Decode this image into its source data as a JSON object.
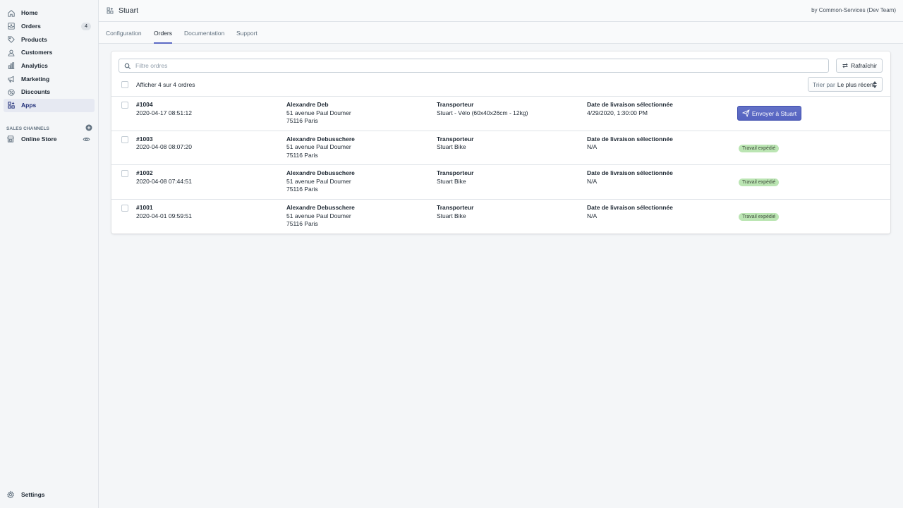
{
  "sidebar": {
    "items": [
      {
        "label": "Home",
        "icon": "home-icon"
      },
      {
        "label": "Orders",
        "icon": "orders-icon",
        "badge": "4"
      },
      {
        "label": "Products",
        "icon": "tag-icon"
      },
      {
        "label": "Customers",
        "icon": "person-icon"
      },
      {
        "label": "Analytics",
        "icon": "bar-chart-icon"
      },
      {
        "label": "Marketing",
        "icon": "megaphone-icon"
      },
      {
        "label": "Discounts",
        "icon": "discount-icon"
      },
      {
        "label": "Apps",
        "icon": "apps-icon",
        "active": true
      }
    ],
    "sales_channels_label": "SALES CHANNELS",
    "online_store_label": "Online Store",
    "settings_label": "Settings"
  },
  "header": {
    "app_title": "Stuart",
    "by_text": "by Common-Services (Dev Team)"
  },
  "tabs": [
    {
      "label": "Configuration"
    },
    {
      "label": "Orders",
      "active": true
    },
    {
      "label": "Documentation"
    },
    {
      "label": "Support"
    }
  ],
  "toolbar": {
    "search_placeholder": "Filtre ordres",
    "refresh_label": "Rafraîchir",
    "count_text": "Afficher 4 sur 4 ordres",
    "sort_prefix": "Trier par",
    "sort_value": "Le plus récent"
  },
  "orders": [
    {
      "id": "#1004",
      "date": "2020-04-17 08:51:12",
      "name": "Alexandre Deb",
      "address1": "51 avenue Paul Doumer",
      "address2": "75116 Paris",
      "carrier_label": "Transporteur",
      "carrier": "Stuart - Vélo (60x40x26cm - 12kg)",
      "delivery_label": "Date de livraison sélectionnée",
      "delivery": "4/29/2020, 1:30:00 PM",
      "action": "Envoyer à Stuart"
    },
    {
      "id": "#1003",
      "date": "2020-04-08 08:07:20",
      "name": "Alexandre Debusschere",
      "address1": "51 avenue Paul Doumer",
      "address2": "75116 Paris",
      "carrier_label": "Transporteur",
      "carrier": "Stuart Bike",
      "delivery_label": "Date de livraison sélectionnée",
      "delivery": "N/A",
      "status": "Travail expédié"
    },
    {
      "id": "#1002",
      "date": "2020-04-08 07:44:51",
      "name": "Alexandre Debusschere",
      "address1": "51 avenue Paul Doumer",
      "address2": "75116 Paris",
      "carrier_label": "Transporteur",
      "carrier": "Stuart Bike",
      "delivery_label": "Date de livraison sélectionnée",
      "delivery": "N/A",
      "status": "Travail expédié"
    },
    {
      "id": "#1001",
      "date": "2020-04-01 09:59:51",
      "name": "Alexandre Debusschere",
      "address1": "51 avenue Paul Doumer",
      "address2": "75116 Paris",
      "carrier_label": "Transporteur",
      "carrier": "Stuart Bike",
      "delivery_label": "Date de livraison sélectionnée",
      "delivery": "N/A",
      "status": "Travail expédié"
    }
  ],
  "colors": {
    "accent": "#5c6ac4",
    "success_badge": "#bbe5b3",
    "active_nav": "#202e78"
  }
}
